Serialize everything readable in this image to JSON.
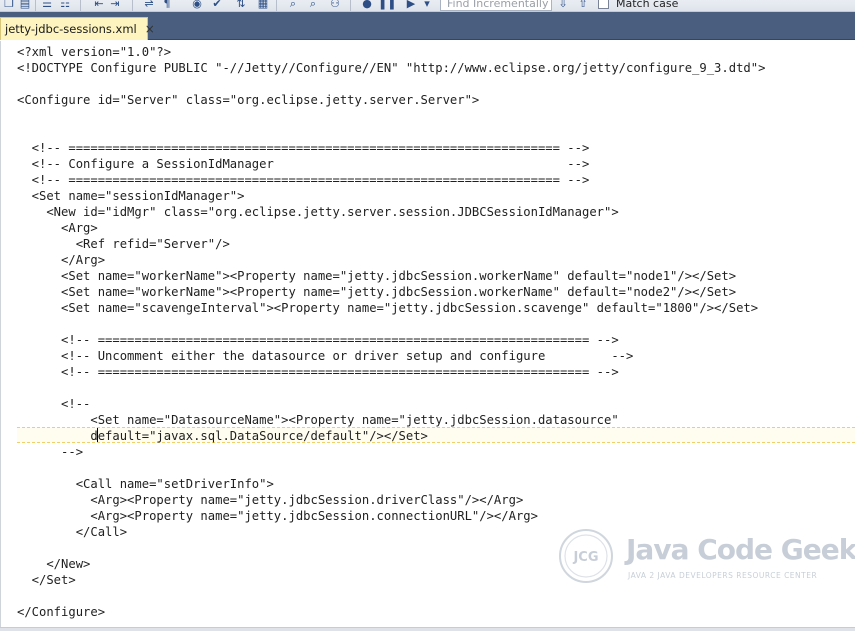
{
  "toolbar": {
    "find_placeholder": "Find Incrementally",
    "match_case_label": "Match case"
  },
  "tab": {
    "label": "jetty-jdbc-sessions.xml",
    "close_glyph": "×"
  },
  "editor": {
    "lines": [
      "<?xml version=\"1.0\"?>",
      "<!DOCTYPE Configure PUBLIC \"-//Jetty//Configure//EN\" \"http://www.eclipse.org/jetty/configure_9_3.dtd\">",
      "",
      "<Configure id=\"Server\" class=\"org.eclipse.jetty.server.Server\">",
      "",
      "",
      "  <!-- =================================================================== -->",
      "  <!-- Configure a SessionIdManager                                        -->",
      "  <!-- =================================================================== -->",
      "  <Set name=\"sessionIdManager\">",
      "    <New id=\"idMgr\" class=\"org.eclipse.jetty.server.session.JDBCSessionIdManager\">",
      "      <Arg>",
      "        <Ref refid=\"Server\"/>",
      "      </Arg>",
      "      <Set name=\"workerName\"><Property name=\"jetty.jdbcSession.workerName\" default=\"node1\"/></Set>",
      "      <Set name=\"workerName\"><Property name=\"jetty.jdbcSession.workerName\" default=\"node2\"/></Set>",
      "      <Set name=\"scavengeInterval\"><Property name=\"jetty.jdbcSession.scavenge\" default=\"1800\"/></Set>",
      "",
      "      <!-- =================================================================== -->",
      "      <!-- Uncomment either the datasource or driver setup and configure         -->",
      "      <!-- =================================================================== -->",
      "",
      "      <!--",
      "          <Set name=\"DatasourceName\"><Property name=\"jetty.jdbcSession.datasource\"",
      "          default=\"javax.sql.DataSource/default\"/></Set>",
      "      -->",
      "",
      "        <Call name=\"setDriverInfo\">",
      "          <Arg><Property name=\"jetty.jdbcSession.driverClass\"/></Arg>",
      "          <Arg><Property name=\"jetty.jdbcSession.connectionURL\"/></Arg>",
      "        </Call>",
      "",
      "    </New>",
      "  </Set>",
      "",
      "</Configure>"
    ]
  },
  "watermark": {
    "brand": "Java Code Geeks",
    "tagline": "JAVA 2 JAVA DEVELOPERS RESOURCE CENTER",
    "badge": "JCG"
  }
}
